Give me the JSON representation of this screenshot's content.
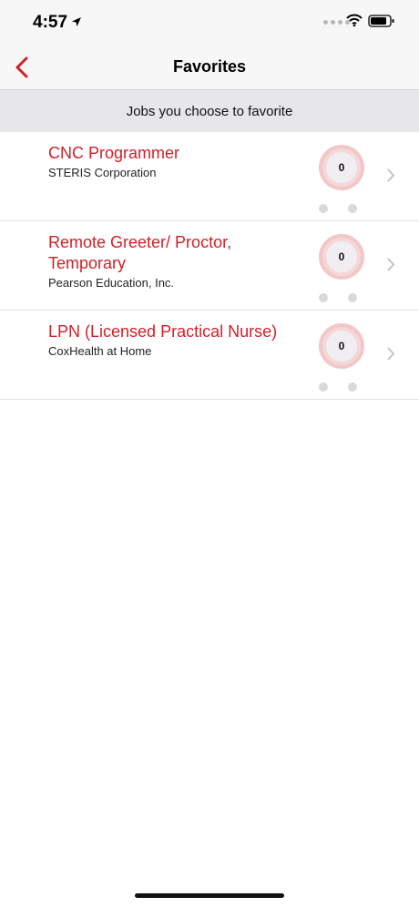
{
  "status_bar": {
    "time": "4:57"
  },
  "nav": {
    "title": "Favorites"
  },
  "section": {
    "header": "Jobs you choose to favorite"
  },
  "jobs": [
    {
      "title": "CNC Programmer",
      "company": "STERIS Corporation",
      "score": "0"
    },
    {
      "title": "Remote Greeter/ Proctor, Temporary",
      "company": "Pearson Education, Inc.",
      "score": "0"
    },
    {
      "title": "LPN (Licensed Practical Nurse)",
      "company": "CoxHealth at Home",
      "score": "0"
    }
  ],
  "colors": {
    "accent": "#d21f26",
    "score_ring": "#f2c7c9",
    "header_bg": "#e7e7ea"
  },
  "icons": [
    "location-arrow-icon",
    "cellular-signal-icon",
    "wifi-icon",
    "battery-icon",
    "back-chevron-icon",
    "chevron-right-icon"
  ]
}
